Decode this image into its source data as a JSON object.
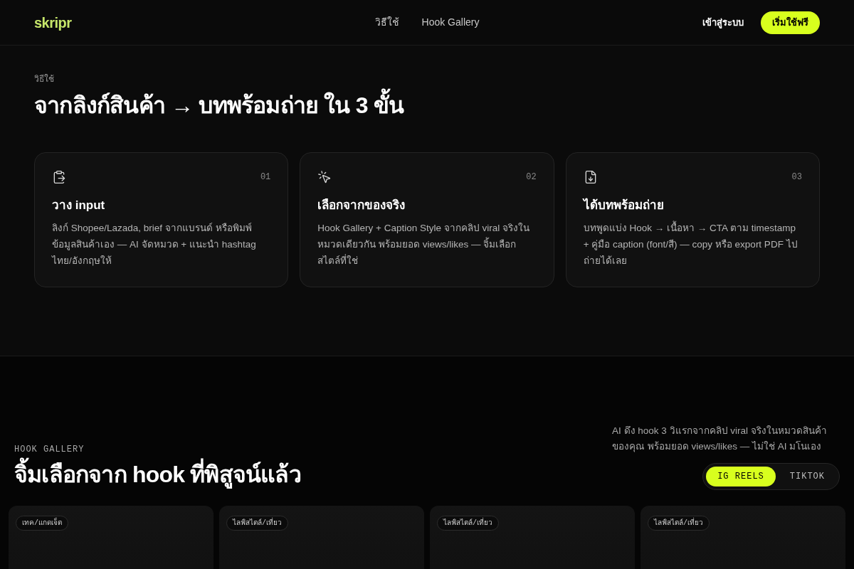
{
  "header": {
    "logo": "skripr",
    "nav": [
      {
        "label": "วิธีใช้"
      },
      {
        "label": "Hook Gallery"
      }
    ],
    "login": "เข้าสู่ระบบ",
    "cta": "เริ่มใช้ฟรี"
  },
  "how_it_works": {
    "eyebrow": "วิธีใช้",
    "title": "จากลิงก์สินค้า → บทพร้อมถ่าย ใน 3 ขั้น",
    "steps": [
      {
        "number": "01",
        "title": "วาง input",
        "description": "ลิงก์ Shopee/Lazada, brief จากแบรนด์ หรือพิมพ์ข้อมูลสินค้าเอง — AI จัดหมวด + แนะนำ hashtag ไทย/อังกฤษให้"
      },
      {
        "number": "02",
        "title": "เลือกจากของจริง",
        "description": "Hook Gallery + Caption Style จากคลิป viral จริงในหมวดเดียวกัน พร้อมยอด views/likes — จิ้มเลือกสไตล์ที่ใช่"
      },
      {
        "number": "03",
        "title": "ได้บทพร้อมถ่าย",
        "description": "บทพูดแบ่ง Hook → เนื้อหา → CTA ตาม timestamp + คู่มือ caption (font/สี) — copy หรือ export PDF ไปถ่ายได้เลย"
      }
    ]
  },
  "hook_gallery": {
    "eyebrow": "HOOK GALLERY",
    "title": "จิ้มเลือกจาก hook ที่พิสูจน์แล้ว",
    "description": "AI ดึง hook 3 วิแรกจากคลิป viral จริงในหมวดสินค้าของคุณ พร้อมยอด views/likes — ไม่ใช่ AI มโนเอง",
    "platform_tabs": [
      {
        "label": "IG REELS",
        "selected": true
      },
      {
        "label": "TIKTOK",
        "selected": false
      }
    ],
    "cards": [
      {
        "tag": "เทค/แกดเจ็ต"
      },
      {
        "tag": "ไลฟ์สไตล์/เที่ยว"
      },
      {
        "tag": "ไลฟ์สไตล์/เที่ยว"
      },
      {
        "tag": "ไลฟ์สไตล์/เที่ยว"
      }
    ]
  }
}
